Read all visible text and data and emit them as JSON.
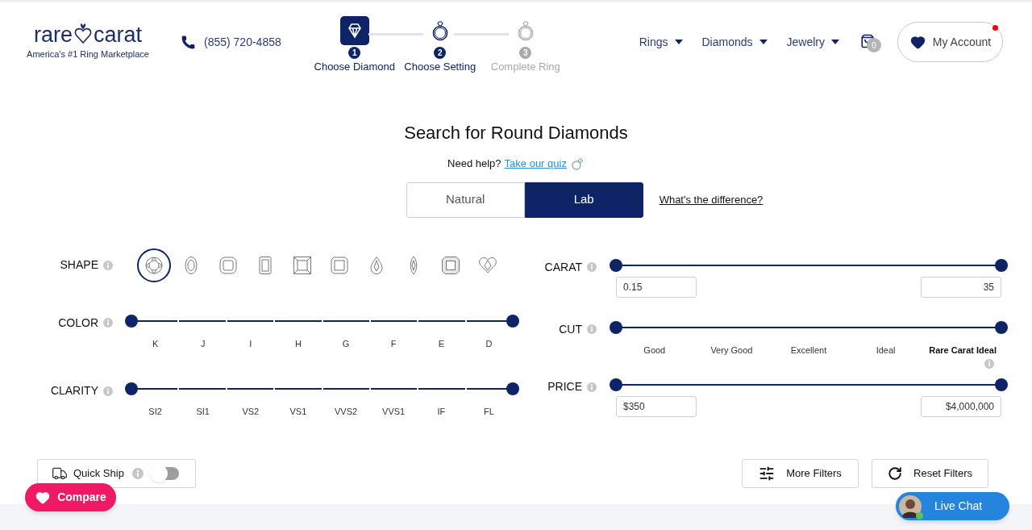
{
  "header": {
    "logo": {
      "word_1": "rare",
      "word_2": "carat",
      "tagline": "America's #1 Ring Marketplace"
    },
    "phone": "(855) 720-4858",
    "steps": [
      {
        "number": "1",
        "label": "Choose Diamond",
        "selected": true,
        "enabled": true
      },
      {
        "number": "2",
        "label": "Choose Setting",
        "selected": false,
        "enabled": true
      },
      {
        "number": "3",
        "label": "Complete Ring",
        "selected": false,
        "enabled": false
      }
    ],
    "nav": [
      "Rings",
      "Diamonds",
      "Jewelry"
    ],
    "cart_count": "0",
    "account": {
      "label": "My Account",
      "notification": true
    }
  },
  "title": "Search for Round Diamonds",
  "help": {
    "text": "Need help?",
    "link": "Take our quiz"
  },
  "origin_tabs": [
    {
      "label": "Natural",
      "selected": false
    },
    {
      "label": "Lab",
      "selected": true
    }
  ],
  "difference_link": "What's the difference?",
  "shape": {
    "label": "SHAPE",
    "options": [
      {
        "kind": "round",
        "selected": true
      },
      {
        "kind": "oval",
        "selected": false
      },
      {
        "kind": "cushion",
        "selected": false
      },
      {
        "kind": "emerald",
        "selected": false
      },
      {
        "kind": "princess",
        "selected": false
      },
      {
        "kind": "radiant",
        "selected": false
      },
      {
        "kind": "pear",
        "selected": false
      },
      {
        "kind": "marquise",
        "selected": false
      },
      {
        "kind": "asscher",
        "selected": false
      },
      {
        "kind": "heart",
        "selected": false
      }
    ]
  },
  "color": {
    "label": "COLOR",
    "thumbs": [
      {
        "level": 0
      },
      {
        "level": 1
      }
    ],
    "grades": [
      "K",
      "J",
      "I",
      "H",
      "G",
      "F",
      "E",
      "D"
    ]
  },
  "clarity": {
    "label": "CLARITY",
    "thumbs": [
      {
        "level": 0
      },
      {
        "level": 1
      }
    ],
    "grades": [
      "SI2",
      "SI1",
      "VS2",
      "VS1",
      "VVS2",
      "VVS1",
      "IF",
      "FL"
    ]
  },
  "carat": {
    "label": "CARAT",
    "thumbs": [
      {
        "level": 0
      },
      {
        "level": 1
      }
    ],
    "min": "0.15",
    "max": "35"
  },
  "cut": {
    "label": "CUT",
    "thumbs": [
      {
        "level": 0
      },
      {
        "level": 1
      }
    ],
    "grades": [
      {
        "label": "Good",
        "bold": false,
        "info": false
      },
      {
        "label": "Very Good",
        "bold": false,
        "info": false
      },
      {
        "label": "Excellent",
        "bold": false,
        "info": false
      },
      {
        "label": "Ideal",
        "bold": false,
        "info": false
      },
      {
        "label": "Rare Carat Ideal",
        "bold": true,
        "info": true
      }
    ]
  },
  "price": {
    "label": "PRICE",
    "thumbs": [
      {
        "level": 0
      },
      {
        "level": 1
      }
    ],
    "min": "$350",
    "max": "$4,000,000"
  },
  "quick_ship": {
    "label": "Quick Ship",
    "on": false
  },
  "buttons": [
    "More Filters",
    "Reset Filters"
  ],
  "compare": "Compare",
  "live_chat": {
    "label": "Live Chat",
    "online": true
  }
}
